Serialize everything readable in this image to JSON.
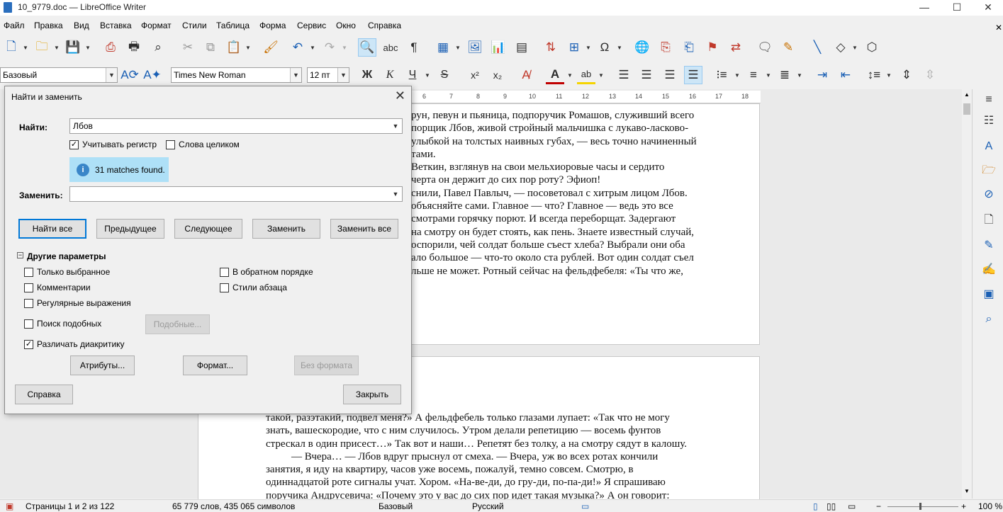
{
  "window": {
    "title": "10_9779.doc — LibreOffice Writer"
  },
  "menu": [
    "Файл",
    "Правка",
    "Вид",
    "Вставка",
    "Формат",
    "Стили",
    "Таблица",
    "Форма",
    "Сервис",
    "Окно",
    "Справка"
  ],
  "toolbar2": {
    "para_style": "Базовый",
    "font_name": "Times New Roman",
    "font_size": "12 пт",
    "bold": "Ж",
    "italic": "К",
    "underline": "Ч",
    "strike": "S"
  },
  "ruler": [
    "6",
    "7",
    "8",
    "9",
    "10",
    "11",
    "12",
    "13",
    "14",
    "15",
    "16",
    "17",
    "18"
  ],
  "document": {
    "page1_lines": [
      "рун, певун и пьяница, подпоручик Ромашов, служивший всего",
      "порщик Лбов, живой стройный мальчишка с лукаво-ласково-",
      "улыбкой на толстых наивных губах, — весь точно начиненный",
      "тами.",
      "Веткин, взглянув на свои мельхиоровые часы и сердито",
      "черта он держит до сих пор роту? Эфиоп!",
      "снили, Павел Павлыч, — посоветовал с хитрым лицом Лбов.",
      "объясняйте сами. Главное — что? Главное — ведь это все",
      "смотрами горячку порют. И всегда переборщат. Задергают",
      "на смотру он будет стоять, как пень. Знаете известный случай,",
      "оспорили, чей солдат больше съест хлеба? Выбрали они оба",
      "ало большое — что-то около ста рублей. Вот один солдат съел",
      "льше не может. Ротный сейчас на фельдфебеля: «Ты что же,"
    ],
    "page2_lines": [
      "такой, разэтакий, подвел меня?» А фельдфебель только глазами лупает: «Так что не могу",
      "знать, вашескородие, что с ним случилось. Утром делали репетицию — восемь фунтов",
      "стрескал в один присест…» Так вот и наши… Репетят без толку, а на смотру сядут в калошу.",
      "— Вчера… — Лбов вдруг прыснул от смеха. — Вчера, уж во всех ротах кончили",
      "занятия, я иду на квартиру, часов уже восемь, пожалуй, темно совсем. Смотрю, в",
      "одиннадцатой роте сигналы учат. Хором. «На-ве-ди, до гру-ди, по-па-ди!» Я спрашиваю",
      "поручика Андрусевича: «Почему это у вас до сих пор идет такая музыка?» А он говорит:"
    ]
  },
  "dialog": {
    "title": "Найти и заменить",
    "find_label": "Найти:",
    "find_value": "Лбов",
    "match_case": "Учитывать регистр",
    "whole_words": "Слова целиком",
    "info": "31 matches found.",
    "replace_label": "Заменить:",
    "replace_value": "",
    "buttons": {
      "find_all": "Найти все",
      "prev": "Предыдущее",
      "next": "Следующее",
      "replace": "Заменить",
      "replace_all": "Заменить все"
    },
    "other_options": "Другие параметры",
    "opts": {
      "selection_only": "Только выбранное",
      "backwards": "В обратном порядке",
      "comments": "Комментарии",
      "para_styles": "Стили абзаца",
      "regex": "Регулярные выражения",
      "similarity": "Поиск подобных",
      "similar_btn": "Подобные...",
      "diacritics": "Различать диакритику"
    },
    "attributes": "Атрибуты...",
    "format": "Формат...",
    "no_format": "Без формата",
    "help": "Справка",
    "close": "Закрыть"
  },
  "status": {
    "pages": "Страницы 1 и 2 из 122",
    "words": "65 779 слов, 435 065 символов",
    "style": "Базовый",
    "lang": "Русский",
    "zoom": "100 %"
  }
}
